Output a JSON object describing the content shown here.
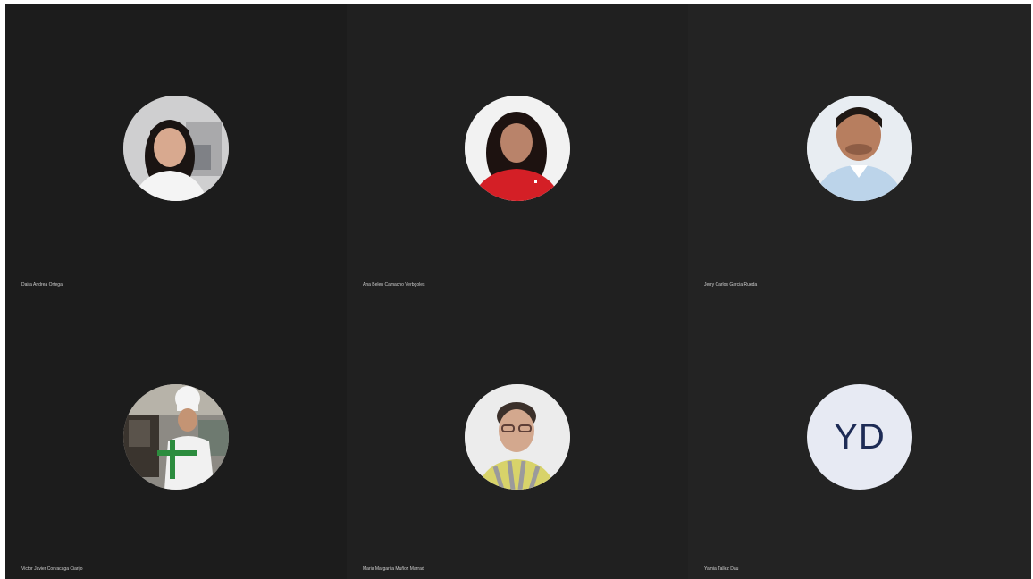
{
  "participants": [
    {
      "name": "Daira Andrea Ortega",
      "avatar_type": "photo",
      "avatar_icon": "woman-portrait"
    },
    {
      "name": "Ana Belen Camacho Verbgoles",
      "avatar_type": "photo",
      "avatar_icon": "woman-red-top-portrait"
    },
    {
      "name": "Jerry Carlos Garcia Rueda",
      "avatar_type": "photo",
      "avatar_icon": "man-portrait"
    },
    {
      "name": "Victor Javier Corvacaga Ciarijo",
      "avatar_type": "photo",
      "avatar_icon": "chef-portrait"
    },
    {
      "name": "Maria Margarita Muñoz Marrad",
      "avatar_type": "photo",
      "avatar_icon": "woman-glasses-portrait"
    },
    {
      "name": "Yamia Tallez Dau",
      "avatar_type": "initials",
      "initials": "YD",
      "avatar_icon": "initials-avatar"
    }
  ],
  "colors": {
    "stage_bg": "#1b1b1b",
    "name_text": "#cfcfcf",
    "initials_bg": "#e7eaf3",
    "initials_text": "#1d2b55"
  }
}
